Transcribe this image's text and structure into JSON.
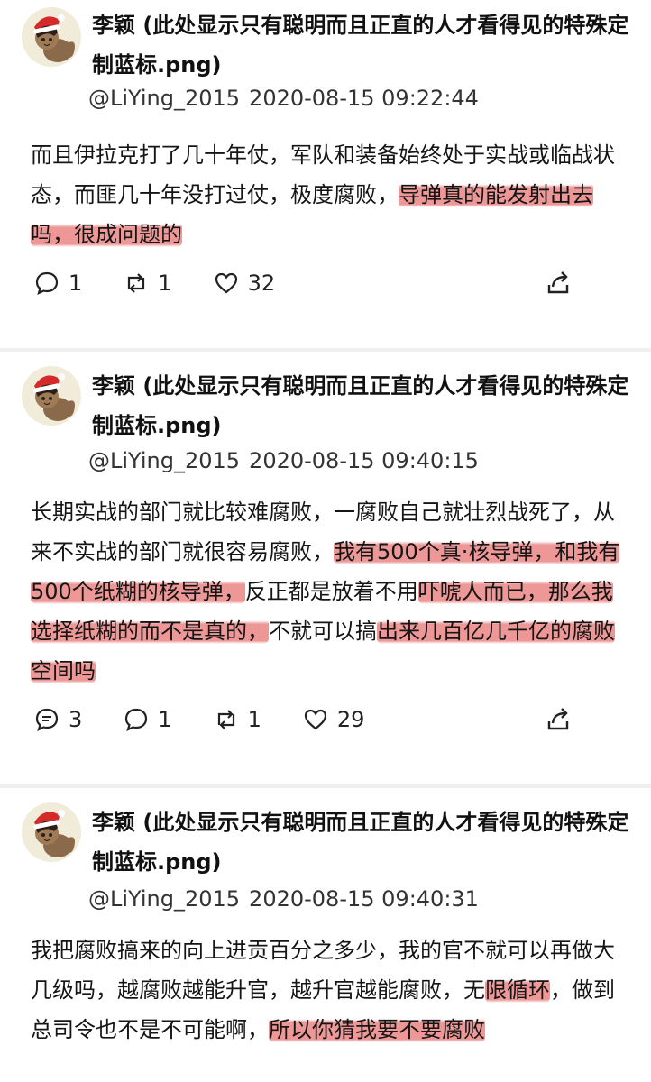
{
  "posts": [
    {
      "author_name": "李颖 (此处显示只有聪明而且正直的人才看得见的特殊定制蓝标.png)",
      "handle": "@LiYing_2015",
      "timestamp": "2020-08-15 09:22:44",
      "text_parts": [
        "而且伊拉克打了几十年仗，军队和装备始终处于实战或临战状态，而匪几十年没打过仗，极度腐败，",
        "导弹真的能发射出去吗，很成问题的"
      ],
      "replies": "1",
      "reposts": "1",
      "likes": "32"
    },
    {
      "author_name": "李颖 (此处显示只有聪明而且正直的人才看得见的特殊定制蓝标.png)",
      "handle": "@LiYing_2015",
      "timestamp": "2020-08-15 09:40:15",
      "text_parts": [
        "长期实战的部门就比较难腐败，一腐败自己就壮烈战死了，从来不实战的部门就很容易腐败，",
        "我有500个真·核导弹，和我有500个纸糊的核导弹，",
        "反正都是放着不用",
        "吓唬人而已，那么我选择纸糊的而不是真的，",
        "不就可以搞",
        "出来几百亿几千亿的腐败空间吗"
      ],
      "quotes": "3",
      "replies": "1",
      "reposts": "1",
      "likes": "29"
    },
    {
      "author_name": "李颖 (此处显示只有聪明而且正直的人才看得见的特殊定制蓝标.png)",
      "handle": "@LiYing_2015",
      "timestamp": "2020-08-15 09:40:31",
      "text_parts": [
        "我把腐败搞来的向上进贡百分之多少，我的官不就可以再做大几级吗，越腐败越能升官，越升官越能腐败，无",
        "限循环",
        "，做到总司令也不是不可能啊，",
        "所以你猜我要不要腐败"
      ]
    }
  ],
  "icons": {
    "reply": "speech-bubble-icon",
    "repost": "repost-arrows-icon",
    "like": "heart-icon",
    "quote": "quote-bubble-icon",
    "share": "share-icon",
    "avatar": "santa-hat-dog-avatar"
  },
  "colors": {
    "highlight": "#e97a7a",
    "separator": "#f0f0f2",
    "text": "#111111"
  }
}
